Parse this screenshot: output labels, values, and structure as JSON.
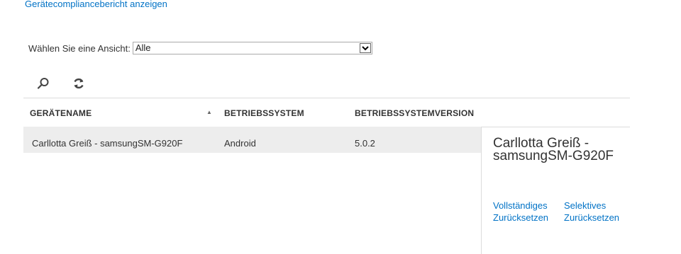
{
  "header": {
    "report_link": "Gerätecompliancebericht anzeigen"
  },
  "view_filter": {
    "label": "Wählen Sie eine Ansicht:",
    "selected": "Alle"
  },
  "toolbar": {
    "search_icon": "search-icon",
    "refresh_icon": "refresh-icon"
  },
  "table": {
    "columns": [
      "GERÄTENAME",
      "BETRIEBSSYSTEM",
      "BETRIEBSSYSTEMVERSION"
    ],
    "rows": [
      {
        "device_name": "Carllotta Greiß - samsungSM-G920F",
        "os": "Android",
        "os_version": "5.0.2"
      }
    ]
  },
  "detail": {
    "title": "Carllotta Greiß - samsungSM-G920F",
    "actions": [
      {
        "line1": "Vollständiges",
        "line2": "Zurücksetzen"
      },
      {
        "line1": "Selektives",
        "line2": "Zurücksetzen"
      }
    ]
  }
}
